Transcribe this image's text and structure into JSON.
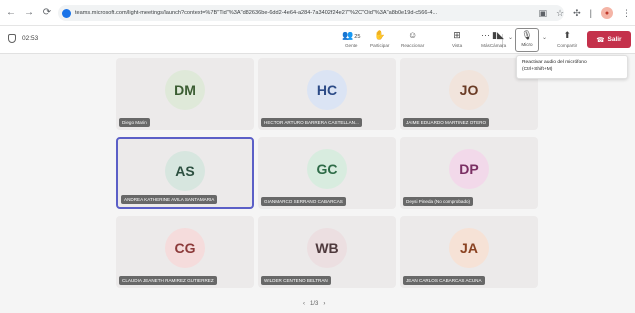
{
  "browser": {
    "url": "teams.microsoft.com/light-meetings/launch?context=%7B\"Tid\"%3A\"d82636be-6dd2-4e64-a284-7a3402f24e27\"%2C\"Oid\"%3A\"a8b0e19d-c566-4...",
    "icons": [
      "back-icon",
      "forward-icon",
      "reload-icon",
      "site-icon",
      "extension-icon",
      "star-icon",
      "puzzle-icon",
      "profile-icon",
      "menu-icon"
    ]
  },
  "meeting": {
    "timer": "02:53",
    "toolbar": {
      "people_count": "25",
      "people": "Gente",
      "raise": "Participar",
      "react": "Reaccionar",
      "view": "Vista",
      "more": "Más",
      "camera": "Cámara",
      "mic": "Micro",
      "share": "Compartir",
      "leave": "Salir"
    },
    "tooltip": {
      "line1": "Reactivar audio del micrófono",
      "line2": "(Ctrl+Shift+M)"
    },
    "colors": {
      "leave": "#c4314b",
      "active_border": "#5b5fc7"
    }
  },
  "participants": [
    {
      "initials": "DM",
      "name": "Diego Marin",
      "bg": "#dfe9d9",
      "fg": "#3b5d32"
    },
    {
      "initials": "HC",
      "name": "HECTOR ARTURO BARRERA CASTELLAN...",
      "bg": "#dbe4f4",
      "fg": "#2b4a86"
    },
    {
      "initials": "JO",
      "name": "JAIME EDUARDO MARTINEZ OTERO",
      "bg": "#f1e4dc",
      "fg": "#6a3b25"
    },
    {
      "initials": "AS",
      "name": "ANDREA KATHERINE AVILA SANTAMARIA",
      "bg": "#d7e6df",
      "fg": "#2c5040"
    },
    {
      "initials": "GC",
      "name": "GIANMARCO SERRANO CABARCAS",
      "bg": "#d8ecdf",
      "fg": "#2e6b47"
    },
    {
      "initials": "DP",
      "name": "Deysi Pineda (No comprobado)",
      "bg": "#f2d9ea",
      "fg": "#7a2f63"
    },
    {
      "initials": "CG",
      "name": "CLAUDIA JEANETH RAMIREZ GUTIERREZ",
      "bg": "#f5dcdc",
      "fg": "#8c3a3a"
    },
    {
      "initials": "WB",
      "name": "WILDER CENTENO BELTRAN",
      "bg": "#ecdfe1",
      "fg": "#4f3a3d"
    },
    {
      "initials": "JA",
      "name": "JEAN CARLOS CABARCAS ACUNA",
      "bg": "#f6e2d6",
      "fg": "#8a4221"
    }
  ],
  "pager": {
    "label": "1/3"
  }
}
